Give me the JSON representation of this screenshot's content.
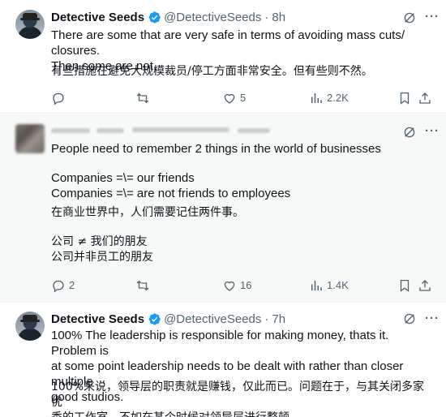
{
  "tweets": [
    {
      "name": "Detective Seeds",
      "handle": "@DetectiveSeeds",
      "time": "8h",
      "lines": [
        "There are some that are very safe in terms of avoiding mass cuts/ closures.",
        "Then some are not."
      ],
      "cn": "有些措施在避免大规模裁员/停工方面非常安全。但有些则不然。",
      "replies": "",
      "likes": "5",
      "views": "2.2K"
    },
    {
      "line1": "People need to remember 2 things in the world of businesses",
      "line2": "Companies =\\= our friends",
      "line3": "Companies =\\= are not friends to employees",
      "cn1": "在商业世界中，人们需要记住两件事。",
      "cn2": "公司 ≠ 我们的朋友",
      "cn3": "公司并非员工的朋友",
      "replies": "2",
      "likes": "16",
      "views": "1.4K"
    },
    {
      "name": "Detective Seeds",
      "handle": "@DetectiveSeeds",
      "time": "7h",
      "lines": [
        "100% The leadership is responsible for making money, thats it. Problem is",
        "at some point leadership needs to be dealt with rather than closer multiple",
        "good studios."
      ],
      "cn1": "100%来说，领导层的职责就是赚钱，仅此而已。问题在于，与其关闭多家优",
      "cn2": "秀的工作室，不如在某个时候对领导层进行整顿。"
    }
  ],
  "separator": "·",
  "more_label": "···",
  "colors": {
    "text": "#0f1419",
    "secondary": "#536471",
    "verified": "#1d9bf0",
    "highlight_bg": "#f7f9f9"
  },
  "icons": [
    "verified-badge-icon",
    "grok-icon",
    "reply-icon",
    "retweet-icon",
    "like-icon",
    "views-icon",
    "bookmark-icon",
    "share-icon"
  ]
}
